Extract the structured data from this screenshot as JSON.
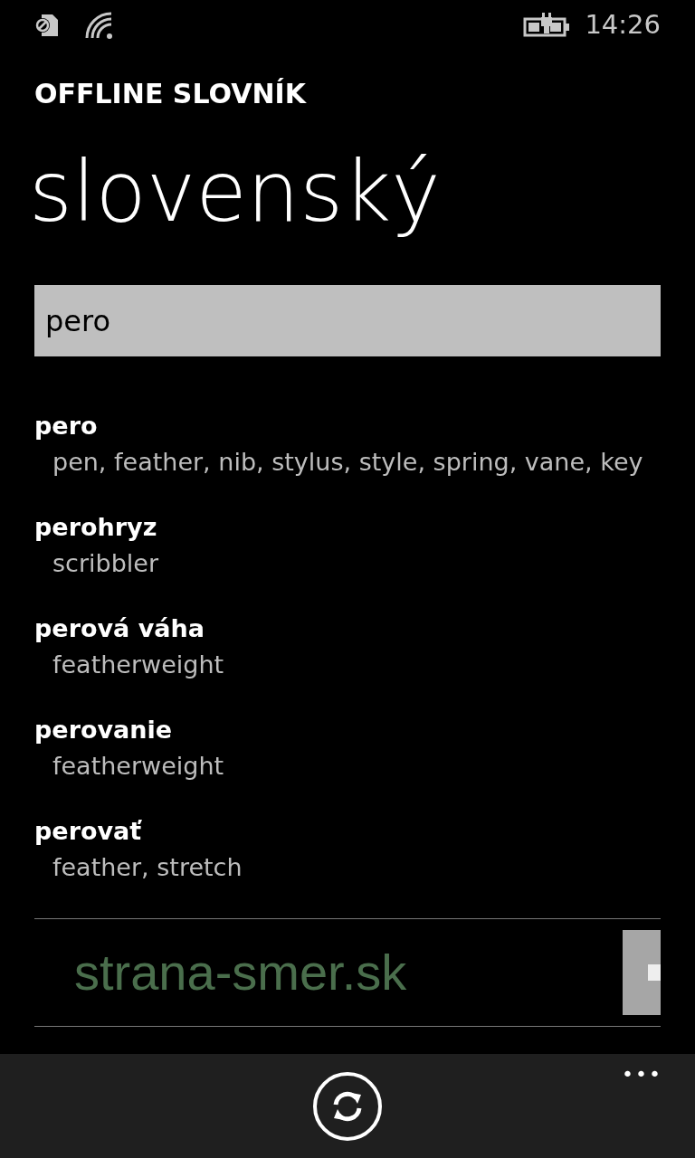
{
  "status_bar": {
    "time": "14:26"
  },
  "app_title": "OFFLINE SLOVNÍK",
  "page_title": "slovenský",
  "search": {
    "value": "pero"
  },
  "results": [
    {
      "word": "pero",
      "translation": "pen, feather, nib, stylus, style, spring, vane, key"
    },
    {
      "word": "perohryz",
      "translation": "scribbler"
    },
    {
      "word": "perová váha",
      "translation": "featherweight"
    },
    {
      "word": "perovanie",
      "translation": "featherweight"
    },
    {
      "word": "perovať",
      "translation": "feather, stretch"
    }
  ],
  "ad": {
    "text": "strana-smer.sk"
  },
  "app_bar": {
    "more": "•••"
  }
}
